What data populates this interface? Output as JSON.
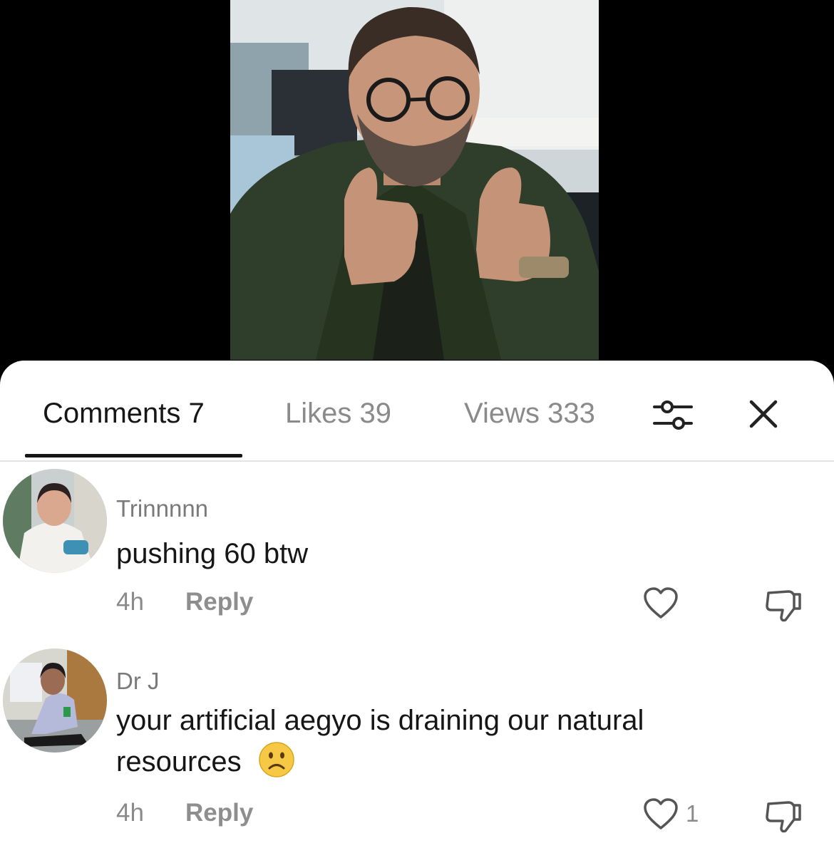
{
  "tabs": {
    "comments": "Comments 7",
    "likes": "Likes 39",
    "views": "Views 333"
  },
  "icons": {
    "filter": "sliders-icon",
    "close": "close-icon",
    "like": "heart-icon",
    "dislike": "thumbs-down-icon",
    "emoji": "slightly-frowning-face"
  },
  "comments": [
    {
      "username": "Trinnnnn",
      "text": "pushing 60 btw",
      "time": "4h",
      "reply_label": "Reply",
      "like_count": ""
    },
    {
      "username": "Dr J",
      "text": "your artificial aegyo is draining our natural resources",
      "time": "4h",
      "reply_label": "Reply",
      "like_count": "1"
    }
  ],
  "colors": {
    "background_top": "#000000",
    "sheet": "#ffffff",
    "active_text": "#161616",
    "muted_text": "#8a8a8a"
  }
}
